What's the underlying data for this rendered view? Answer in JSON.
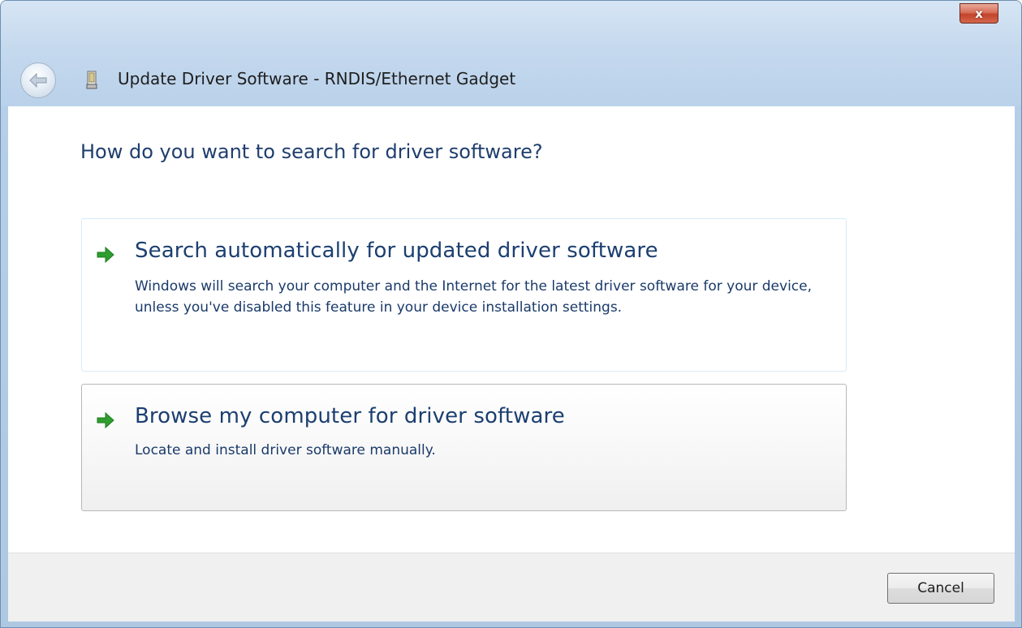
{
  "window": {
    "title": "Update Driver Software - RNDIS/Ethernet Gadget",
    "close_label": "x"
  },
  "icons": {
    "back": "back-arrow-icon",
    "device": "device-icon",
    "close": "close-icon",
    "option_arrow": "green-arrow-icon"
  },
  "main": {
    "heading": "How do you want to search for driver software?",
    "options": [
      {
        "title": "Search automatically for updated driver software",
        "description": "Windows will search your computer and the Internet for the latest driver software for your device, unless you've disabled this feature in your device installation settings."
      },
      {
        "title": "Browse my computer for driver software",
        "description": "Locate and install driver software manually."
      }
    ]
  },
  "footer": {
    "cancel_label": "Cancel"
  },
  "colors": {
    "heading": "#1f3e6e",
    "option_text": "#1c3f70",
    "arrow_green": "#2e9e2e",
    "close_red": "#c2432a"
  }
}
